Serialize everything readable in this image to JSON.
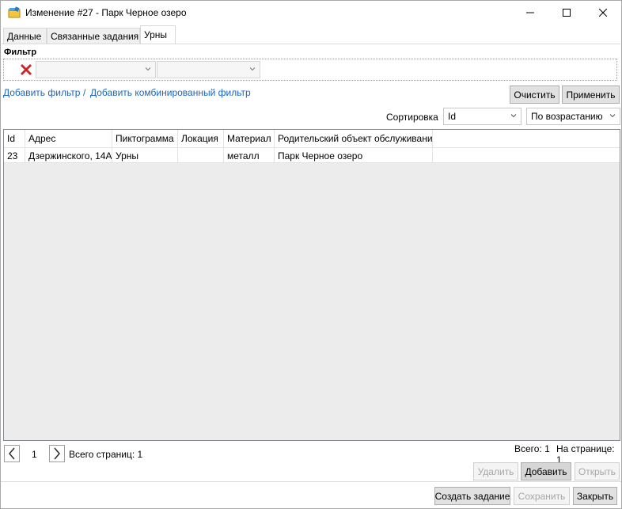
{
  "window": {
    "title": "Изменение #27 - Парк Черное озеро"
  },
  "tabs": [
    {
      "label": "Данные"
    },
    {
      "label": "Связанные задания"
    },
    {
      "label": "Урны"
    }
  ],
  "filter": {
    "label": "Фильтр",
    "add_filter": "Добавить фильтр",
    "separator": "/",
    "add_combined_filter": "Добавить комбинированный фильтр",
    "clear_label": "Очистить",
    "apply_label": "Применить"
  },
  "sort": {
    "label": "Сортировка",
    "field": "Id",
    "direction": "По возрастанию"
  },
  "grid": {
    "columns": [
      "Id",
      "Адрес",
      "Пиктограмма",
      "Локация",
      "Материал",
      "Родительский объект обслуживани"
    ],
    "rows": [
      [
        "23",
        "Дзержинского, 14А",
        "Урны",
        "",
        "металл",
        "Парк Черное озеро"
      ]
    ]
  },
  "pager": {
    "current_page": "1",
    "total_pages_text": "Всего страниц: 1",
    "total_text": "Всего: 1",
    "per_page_text": "На странице: 1"
  },
  "actions": {
    "delete_label": "Удалить",
    "add_label": "Добавить",
    "open_label": "Открыть"
  },
  "footer": {
    "create_task_label": "Создать задание",
    "save_label": "Сохранить",
    "close_label": "Закрыть"
  }
}
